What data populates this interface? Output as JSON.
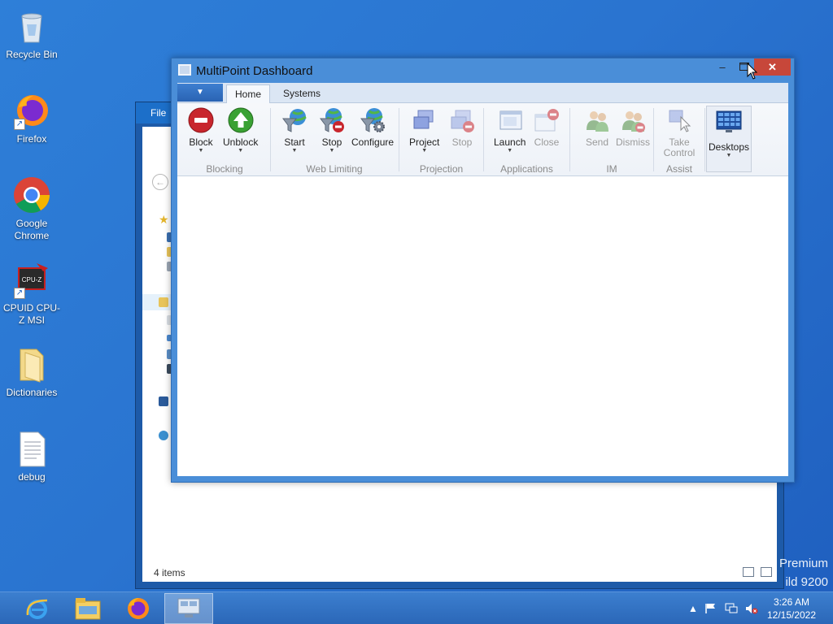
{
  "desktop": {
    "icons": [
      {
        "label": "Recycle Bin"
      },
      {
        "label": "Firefox"
      },
      {
        "label": "Google Chrome"
      },
      {
        "label": "CPUID CPU-Z MSI"
      },
      {
        "label": "Dictionaries"
      },
      {
        "label": "debug"
      }
    ],
    "watermark_line1": "Premium",
    "watermark_line2": "ild 9200"
  },
  "explorer": {
    "file_tab": "File",
    "status": "4 items"
  },
  "dashboard": {
    "title": "MultiPoint Dashboard",
    "tabs": [
      {
        "label": "Home",
        "active": true
      },
      {
        "label": "Systems",
        "active": false
      }
    ],
    "groups": [
      {
        "label": "Blocking",
        "buttons": [
          "Block",
          "Unblock"
        ]
      },
      {
        "label": "Web Limiting",
        "buttons": [
          "Start",
          "Stop",
          "Configure"
        ]
      },
      {
        "label": "Projection",
        "buttons": [
          "Project",
          "Stop"
        ]
      },
      {
        "label": "Applications",
        "buttons": [
          "Launch",
          "Close"
        ]
      },
      {
        "label": "IM",
        "buttons": [
          "Send",
          "Dismiss"
        ]
      },
      {
        "label": "Assist",
        "buttons": [
          "Take Control"
        ]
      },
      {
        "label": "",
        "buttons": [
          "Desktops"
        ]
      }
    ]
  },
  "taskbar": {
    "apps": [
      "internet-explorer",
      "file-explorer",
      "firefox",
      "multipoint-dashboard"
    ],
    "time": "3:26 AM",
    "date": "12/15/2022"
  },
  "colors": {
    "desktop": "#2a74d0",
    "taskbar": "#2b67b8",
    "close_button": "#c7473a",
    "block_red": "#c8262d",
    "unblock_green": "#3aa133"
  }
}
